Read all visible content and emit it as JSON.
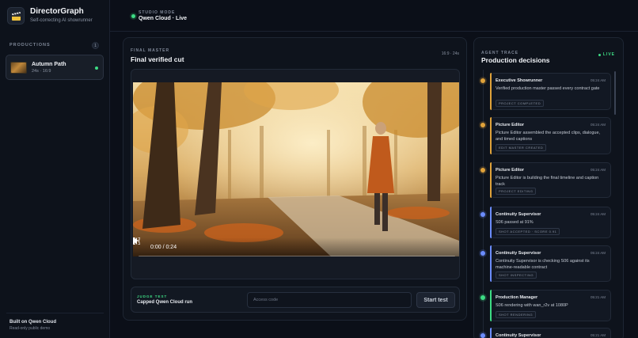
{
  "app": {
    "title": "DirectorGraph",
    "subtitle": "Self-correcting AI showrunner"
  },
  "sidebar": {
    "section_label": "PRODUCTIONS",
    "count": "1",
    "productions": [
      {
        "title": "Autumn Path",
        "meta": "24s · 16:9",
        "status": "live"
      }
    ],
    "footer_title": "Built on Qwen Cloud",
    "footer_sub": "Read-only public demo"
  },
  "topbar": {
    "studio_label": "STUDIO MODE",
    "studio_value": "Qwen Cloud · Live"
  },
  "master": {
    "kicker": "FINAL MASTER",
    "title": "Final verified cut",
    "aspect": "16:9 · 24s"
  },
  "player": {
    "time": "0:00 / 0:24",
    "progress": 0.0
  },
  "judge": {
    "kicker": "JUDGE TEST",
    "title": "Capped Qwen Cloud run",
    "input_placeholder": "Access code",
    "input_value": "",
    "button_label": "Start test"
  },
  "trace": {
    "kicker": "AGENT TRACE",
    "title": "Production decisions",
    "live_label": "LIVE",
    "items": [
      {
        "agent": "Executive Showrunner",
        "time": "05:24 AM",
        "message": "Verified production master passed every contract gate",
        "tag": "PROJECT COMPLETED",
        "color": "#e0a23a"
      },
      {
        "agent": "Picture Editor",
        "time": "05:24 AM",
        "message": "Picture Editor assembled the accepted clips, dialogue, and timed captions",
        "tag": "EDIT MASTER CREATED",
        "color": "#e0a23a"
      },
      {
        "agent": "Picture Editor",
        "time": "05:24 AM",
        "message": "Picture Editor is building the final timeline and caption track",
        "tag": "PROJECT EDITING",
        "color": "#e0a23a"
      },
      {
        "agent": "Continuity Supervisor",
        "time": "05:24 AM",
        "message": "S06 passed at 91%",
        "tag": "SHOT ACCEPTED · SCORE 0.91",
        "color": "#6b8cff"
      },
      {
        "agent": "Continuity Supervisor",
        "time": "05:24 AM",
        "message": "Continuity Supervisor is checking S06 against its machine-readable contract",
        "tag": "SHOT INSPECTING",
        "color": "#6b8cff"
      },
      {
        "agent": "Production Manager",
        "time": "05:21 AM",
        "message": "S06 rendering with wan_r2v at 1080P",
        "tag": "SHOT RENDERING",
        "color": "#3ddc84"
      },
      {
        "agent": "Continuity Supervisor",
        "time": "05:21 AM",
        "message": "",
        "tag": "",
        "color": "#6b8cff"
      }
    ]
  },
  "colors": {
    "accent_green": "#3ddc84",
    "accent_amber": "#e0a23a",
    "accent_blue": "#6b8cff",
    "background": "#0b0f18"
  }
}
